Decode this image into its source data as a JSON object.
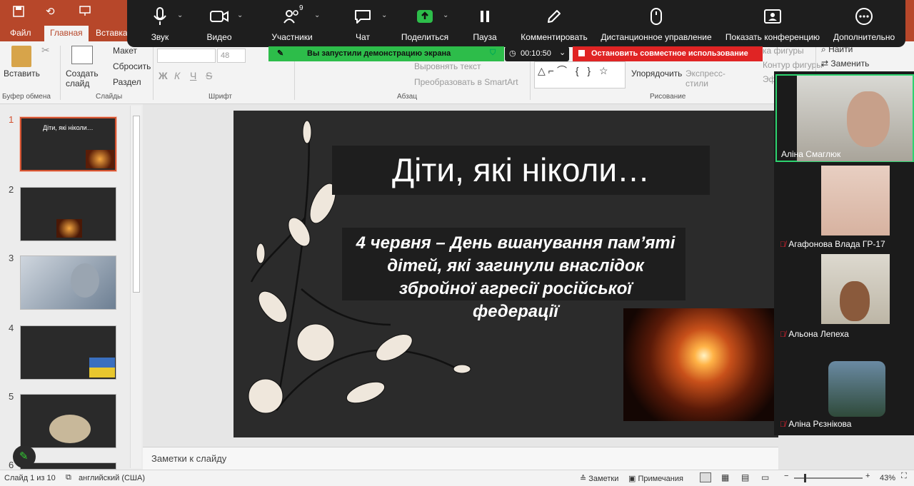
{
  "app": {
    "quick_access": [
      "save-icon",
      "undo-icon",
      "present-icon"
    ],
    "tabs": [
      "Файл",
      "Главная",
      "Вставка"
    ]
  },
  "ribbon": {
    "clipboard": {
      "paste": "Вставить",
      "group": "Буфер обмена"
    },
    "slides": {
      "new_slide": "Создать слайд",
      "layout": "Макет",
      "reset": "Сбросить",
      "section": "Раздел",
      "group": "Слайды"
    },
    "font": {
      "size": "48",
      "group": "Шрифт",
      "bold": "Ж",
      "italic": "К",
      "underline": "Ч",
      "strike": "S"
    },
    "paragraph": {
      "align_text": "Выровнять текст",
      "smartart": "Преобразовать в SmartArt",
      "group": "Абзац"
    },
    "drawing": {
      "arrange": "Упорядочить",
      "quick_styles": "Экспресс-стили",
      "shape_fill": "ка фигуры",
      "shape_outline": "Контур фигуры",
      "effects": "Эффекты",
      "group": "Рисование"
    },
    "editing": {
      "find": "Найти",
      "replace": "Заменить"
    }
  },
  "zoom": {
    "participants_count": "9",
    "buttons": [
      "Звук",
      "Видео",
      "Участники",
      "Чат",
      "Поделиться",
      "Пауза",
      "Комментировать",
      "Дистанционное управление",
      "Показать конференцию",
      "Дополнительно"
    ],
    "share_status": "Вы запустили демонстрацию экрана",
    "timer": "00:10:50",
    "stop_share": "Остановить совместное использование",
    "participants": [
      {
        "name": "Аліна Смаглюк",
        "muted": false
      },
      {
        "name": "Агафонова Влада ГР-17",
        "muted": true
      },
      {
        "name": "Альона Лепеха",
        "muted": true
      },
      {
        "name": "Аліна Рєзнікова",
        "muted": true
      }
    ]
  },
  "thumbnails": {
    "numbers": [
      "1",
      "2",
      "3",
      "4",
      "5",
      "6"
    ],
    "t1_title": "Діти, які ніколи…"
  },
  "slide": {
    "title": "Діти, які ніколи…",
    "subtitle": "4 червня – День вшанування пам’яті дітей, які загинули внаслідок збройної агресії російської федерації"
  },
  "notes_placeholder": "Заметки к слайду",
  "status": {
    "slide_counter": "Слайд 1 из 10",
    "language": "английский (США)",
    "notes": "Заметки",
    "comments": "Примечания",
    "zoom_level": "43%"
  },
  "colors": {
    "powerpoint": "#b7472a",
    "zoom_green": "#2dbd4a",
    "zoom_red": "#e02424",
    "zoom_dark": "#1e1e1e"
  }
}
